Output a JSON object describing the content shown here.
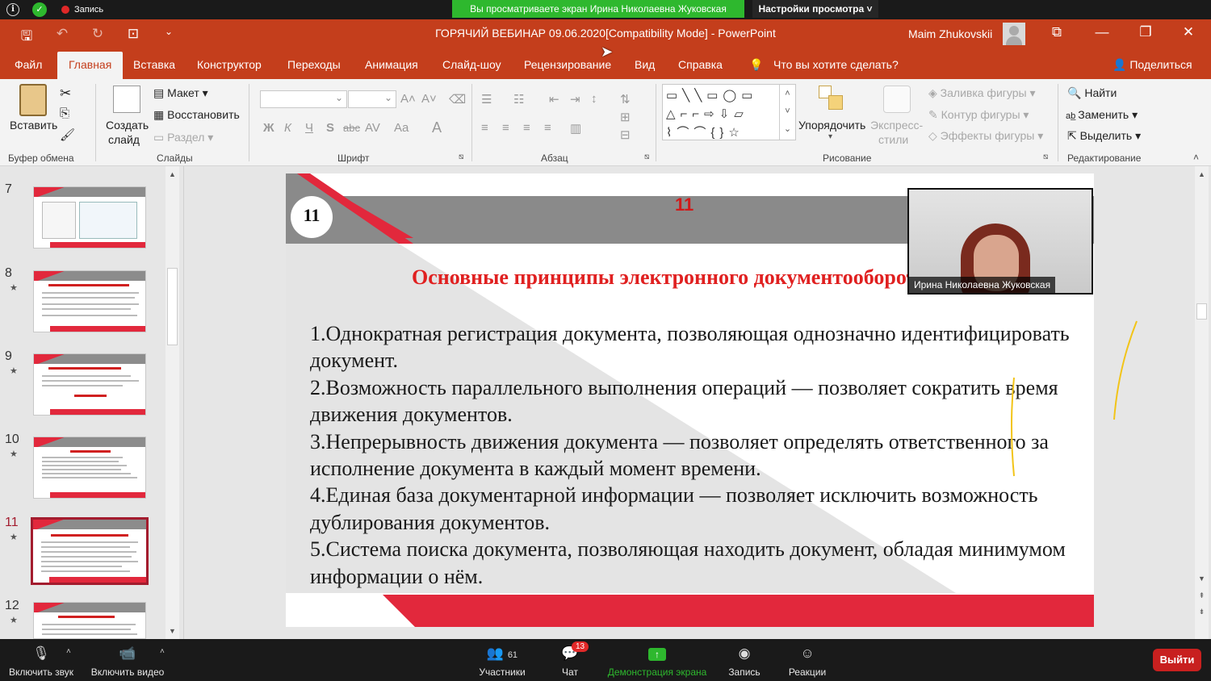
{
  "zoom_top": {
    "record_label": "Запись",
    "viewing_banner": "Вы просматриваете экран Ирина Николаевна Жуковская",
    "view_options": "Настройки просмотра ˅"
  },
  "titlebar": {
    "document_title": "ГОРЯЧИЙ ВЕБИНАР 09.06.2020[Compatibility Mode]  -  PowerPoint",
    "user_name": "Maim Zhukovskii"
  },
  "ribbon_tabs": {
    "file": "Файл",
    "home": "Главная",
    "insert": "Вставка",
    "design": "Конструктор",
    "transitions": "Переходы",
    "animation": "Анимация",
    "slideshow": "Слайд-шоу",
    "review": "Рецензирование",
    "view": "Вид",
    "help": "Справка",
    "tell_me": "Что вы хотите сделать?",
    "share": "Поделиться"
  },
  "ribbon": {
    "paste": "Вставить",
    "clipboard_group": "Буфер обмена",
    "new_slide_1": "Создать",
    "new_slide_2": "слайд",
    "layout": "Макет",
    "reset": "Восстановить",
    "section": "Раздел",
    "slides_group": "Слайды",
    "font_group": "Шрифт",
    "paragraph_group": "Абзац",
    "arrange": "Упорядочить",
    "quick_styles_1": "Экспресс-",
    "quick_styles_2": "стили",
    "shape_fill": "Заливка фигуры",
    "shape_outline": "Контур фигуры",
    "shape_effects": "Эффекты фигуры",
    "drawing_group": "Рисование",
    "find": "Найти",
    "replace": "Заменить",
    "select": "Выделить",
    "editing_group": "Редактирование",
    "bold": "Ж",
    "italic": "К",
    "underline": "Ч",
    "shadow": "S",
    "strike": "abc",
    "spacing": "AV",
    "case": "Aa",
    "font_color": "A"
  },
  "thumbnails": {
    "slide7": "7",
    "slide8": "8",
    "slide9": "9",
    "slide10": "10",
    "slide11": "11",
    "slide12": "12"
  },
  "slide": {
    "number_circle": "11",
    "number_red": "11",
    "heading": "Основные принципы электронного документооборота",
    "items": [
      "1.Однократная регистрация документа, позволяющая однозначно идентифицировать документ.",
      "2.Возможность параллельного выполнения операций — позволяет сократить время движения документов.",
      "3.Непрерывность движения документа — позволяет определять ответственного за исполнение документа в каждый момент времени.",
      "4.Единая база документарной информации — позволяет исключить возможность дублирования документов.",
      "5.Система поиска документа, позволяющая находить документ, обладая минимумом информации о нём."
    ]
  },
  "video": {
    "participant_name": "Ирина Николаевна Жуковская"
  },
  "zoom_bottom": {
    "mute": "Включить звук",
    "video": "Включить видео",
    "participants": "Участники",
    "participants_count": "61",
    "chat": "Чат",
    "chat_badge": "13",
    "share": "Демонстрация экрана",
    "record": "Запись",
    "reactions": "Реакции",
    "leave": "Выйти"
  },
  "colors": {
    "powerpoint_accent": "#c43e1c",
    "slide_red": "#e2283c",
    "zoom_green": "#2eb82e",
    "leave_red": "#c8201f"
  }
}
